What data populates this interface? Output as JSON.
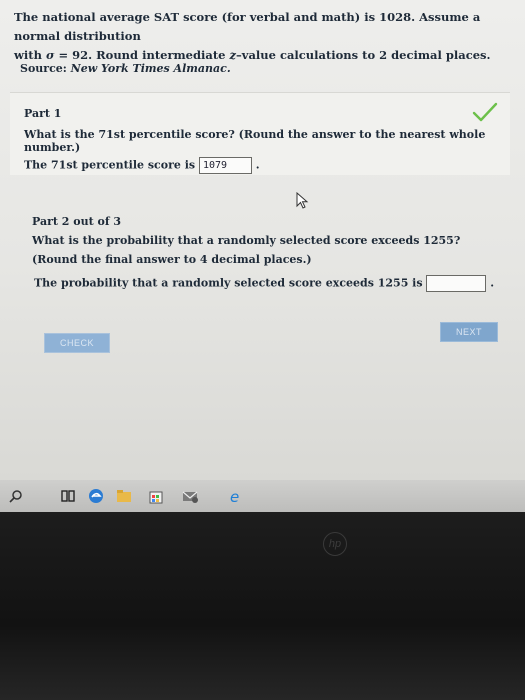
{
  "problem": {
    "line1": "The national average SAT score (for verbal and math) is 1028. Assume a normal distribution",
    "line2_pre": "with ",
    "sigma": "σ",
    "line2_mid": " = 92. Round intermediate ",
    "zvar": "z",
    "line2_post": "–value calculations to 2 decimal places."
  },
  "source": {
    "label": "Source: ",
    "name": "New York Times Almanac."
  },
  "part1": {
    "title": "Part 1",
    "question": "What is the 71st percentile score? (Round the answer to the nearest whole number.)",
    "answer_prefix": "The 71st percentile score is",
    "answer_value": "1079",
    "answer_suffix": "."
  },
  "part2": {
    "title": "Part 2 out of 3",
    "question": "What is the probability that a randomly selected score exceeds 1255?",
    "instruction": "(Round the final answer to 4 decimal places.)",
    "answer_prefix": "The probability that a randomly selected score exceeds 1255 is",
    "answer_value": "",
    "answer_suffix": "."
  },
  "buttons": {
    "check": "CHECK",
    "next": "NEXT"
  },
  "bezel": {
    "logo": "hp"
  },
  "colors": {
    "checkmark": "#6cc04a",
    "button": "#8fb2d6"
  }
}
